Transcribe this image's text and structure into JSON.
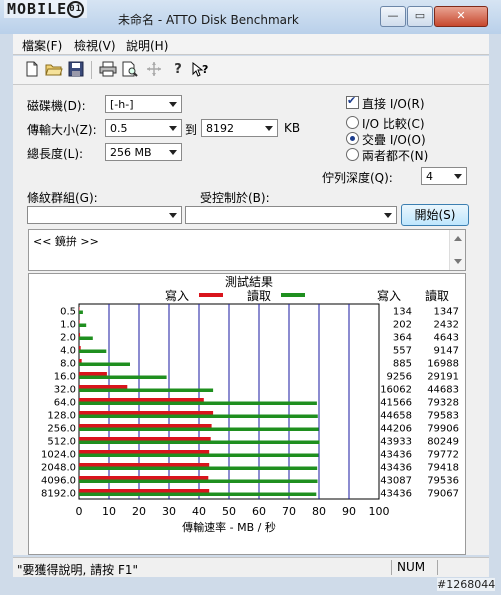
{
  "window": {
    "title": "未命名 - ATTO Disk Benchmark",
    "watermark": "MOBILE01",
    "minimize": "—",
    "maximize": "▭",
    "close": "✕"
  },
  "menu": [
    "檔案(F)",
    "檢視(V)",
    "說明(H)"
  ],
  "toolbar": [
    "new-document-icon",
    "open-folder-icon",
    "save-icon",
    "print-icon",
    "print-preview-icon",
    "move-icon",
    "help-icon",
    "context-help-icon"
  ],
  "settings": {
    "drive_label": "磁碟機(D):",
    "drive_value": "[-h-]",
    "transfer_label": "傳輸大小(Z):",
    "transfer_from": "0.5",
    "transfer_to_label": "到",
    "transfer_to": "8192",
    "transfer_unit": "KB",
    "length_label": "總長度(L):",
    "length_value": "256 MB",
    "direct_io": "直接 I/O(R)",
    "io_compare": "I/O 比較(C)",
    "overlapped_io": "交疊 I/O(O)",
    "neither": "兩者都不(N)",
    "queue_label": "佇列深度(Q):",
    "queue_value": "4",
    "pattern_label": "條紋群組(G):",
    "controlled_label": "受控制於(B):",
    "start_button": "開始(S)"
  },
  "description": "<< 鏡拚 >>",
  "results": {
    "title": "測試結果",
    "legend_write": "寫入",
    "legend_read": "讀取",
    "col_write": "寫入",
    "col_read": "讀取",
    "write_color": "#d9141c",
    "read_color": "#1f8f1f"
  },
  "chart_data": {
    "type": "bar",
    "orientation": "horizontal",
    "title": "測試結果",
    "xlabel": "傳輸速率 - MB / 秒",
    "xlim": [
      0,
      100
    ],
    "xticks": [
      0,
      10,
      20,
      30,
      40,
      50,
      60,
      70,
      80,
      90,
      100
    ],
    "categories": [
      "0.5",
      "1.0",
      "2.0",
      "4.0",
      "8.0",
      "16.0",
      "32.0",
      "64.0",
      "128.0",
      "256.0",
      "512.0",
      "1024.0",
      "2048.0",
      "4096.0",
      "8192.0"
    ],
    "series": [
      {
        "name": "寫入",
        "values": [
          0.13,
          0.2,
          0.36,
          0.56,
          0.89,
          9.3,
          16.1,
          41.6,
          44.7,
          44.2,
          43.9,
          43.4,
          43.4,
          43.1,
          43.4
        ]
      },
      {
        "name": "讀取",
        "values": [
          1.3,
          2.4,
          4.6,
          9.1,
          17.0,
          29.2,
          44.7,
          79.3,
          79.6,
          79.9,
          80.2,
          79.8,
          79.4,
          79.5,
          79.1
        ]
      }
    ],
    "table": {
      "write": [
        "134",
        "202",
        "364",
        "557",
        "885",
        "9256",
        "16062",
        "41566",
        "44658",
        "44206",
        "43933",
        "43436",
        "43436",
        "43087",
        "43436"
      ],
      "read": [
        "1347",
        "2432",
        "4643",
        "9147",
        "16988",
        "29191",
        "44683",
        "79328",
        "79583",
        "79906",
        "80249",
        "79772",
        "79418",
        "79536",
        "79067"
      ]
    },
    "grid": true,
    "legend": "top-center"
  },
  "status": {
    "text": "\"要獲得說明, 請按 F1\"",
    "num": "NUM"
  },
  "badge": "#1268044"
}
